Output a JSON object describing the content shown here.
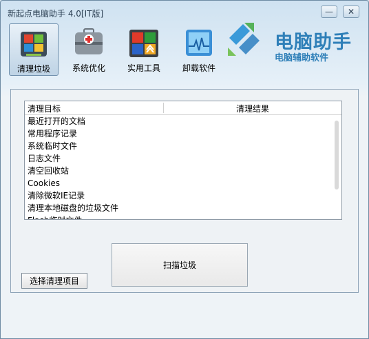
{
  "window": {
    "title": "新起点电脑助手 4.0[IT版]"
  },
  "titlebar": {
    "min_symbol": "—",
    "close_symbol": "✕"
  },
  "toolbar": {
    "items": [
      {
        "label": "清理垃圾",
        "icon": "windows-flag-icon",
        "active": true
      },
      {
        "label": "系统优化",
        "icon": "toolbox-icon",
        "active": false
      },
      {
        "label": "实用工具",
        "icon": "tiles-icon",
        "active": false
      },
      {
        "label": "卸载软件",
        "icon": "monitor-icon",
        "active": false
      }
    ]
  },
  "brand": {
    "title": "电脑助手",
    "subtitle": "电脑辅助软件",
    "color": "#2e7fb8"
  },
  "list": {
    "columns": [
      "清理目标",
      "清理结果"
    ],
    "rows": [
      "最近打开的文档",
      "常用程序记录",
      "系统临时文件",
      "日志文件",
      "清空回收站",
      "Cookies",
      "清除微软IE记录",
      "清理本地磁盘的垃圾文件",
      "Flash临时文件"
    ]
  },
  "buttons": {
    "scan": "扫描垃圾",
    "select_items": "选择清理项目"
  }
}
